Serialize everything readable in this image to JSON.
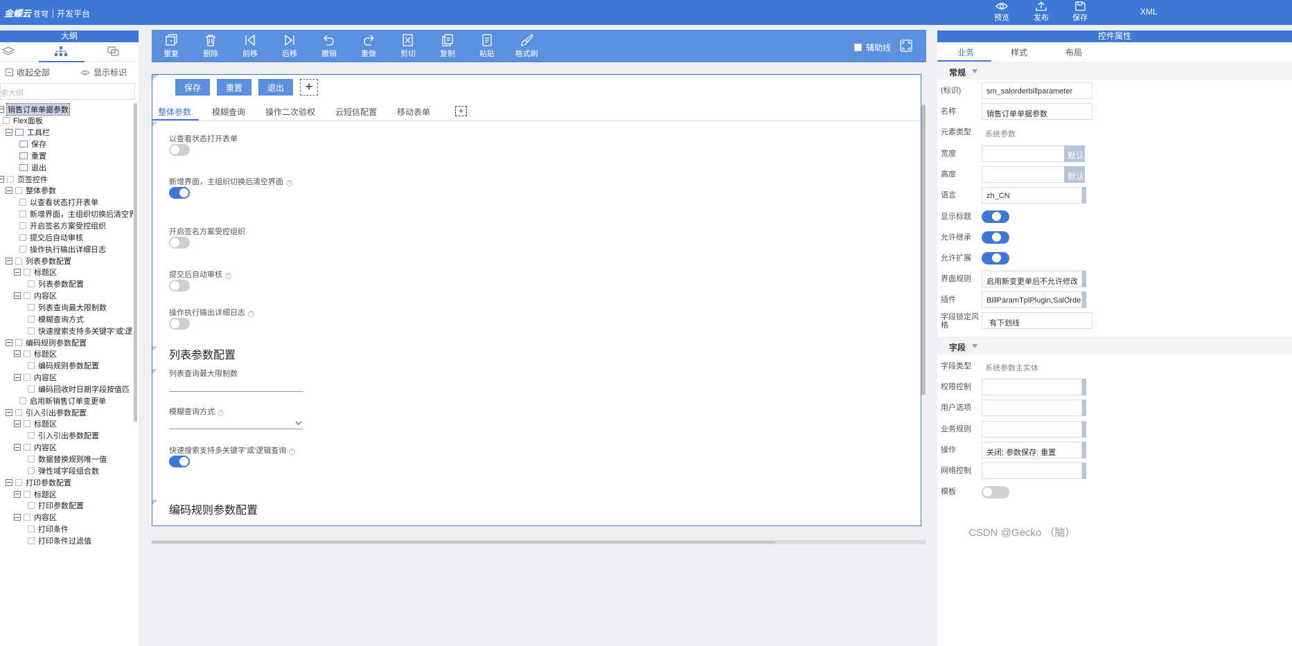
{
  "topbar": {
    "brand": "金蝶云",
    "brand_sub": "苍穹",
    "platform": "开发平台",
    "xml_label": "XML",
    "preview_label": "预览",
    "publish_label": "发布",
    "save_label": "保存"
  },
  "outline": {
    "title": "大纲",
    "collapse_all": "收起全部",
    "show_marks": "显示标识",
    "search_placeholder": "索大纲",
    "items": [
      "销售订单单据参数",
      "Flex面板",
      "工具栏",
      "保存",
      "重置",
      "退出",
      "页签控件",
      "整体参数",
      "以查看状态打开表单",
      "新增界面，主组织切换后清空界面",
      "开启签名方案受控组织",
      "提交后自动审核",
      "操作执行输出详细日志",
      "列表参数配置",
      "标题区",
      "列表参数配置",
      "内容区",
      "列表查询最大限制数",
      "模糊查询方式",
      "快速搜索支持多关键字'或'逻",
      "编码规则参数配置",
      "标题区",
      "编码规则参数配置",
      "内容区",
      "编码回收时日期字段按值匹",
      "启用新销售订单变更单",
      "引入引出参数配置",
      "标题区",
      "引入引出参数配置",
      "内容区",
      "数据替换规则唯一值",
      "弹性域字段组合数",
      "打印参数配置",
      "标题区",
      "打印参数配置",
      "内容区",
      "打印条件",
      "打印条件过滤值"
    ]
  },
  "toolbar": {
    "tools": [
      "重复",
      "删除",
      "前移",
      "后移",
      "撤销",
      "重做",
      "剪切",
      "复制",
      "粘贴",
      "格式刷"
    ],
    "aux_line": "辅助线"
  },
  "designer": {
    "buttons": [
      "保存",
      "重置",
      "退出"
    ],
    "plus": "+",
    "tabs": [
      "整体参数",
      "模糊查询",
      "操作二次验权",
      "云短信配置",
      "移动表单"
    ],
    "fields": {
      "f1": "以查看状态打开表单",
      "f2": "新增界面，主组织切换后清空界面",
      "f3": "开启签名方案受控组织",
      "f4": "提交后自动审核",
      "f5": "操作执行输出详细日志",
      "section2": "列表参数配置",
      "f6": "列表查询最大限制数",
      "f7": "模糊查询方式",
      "f8": "快速搜索支持多关键字'或'逻辑查询",
      "section3": "编码规则参数配置",
      "help": "?"
    },
    "switch_states": [
      false,
      true,
      false,
      false,
      false,
      true
    ]
  },
  "props": {
    "title": "控件属性",
    "tabs": [
      "业务",
      "样式",
      "布局"
    ],
    "group_general": "常规",
    "group_field": "字段",
    "default_btn": "默认",
    "rows": {
      "id_label": "(标识)",
      "id_value": "sm_salorderbillparameter",
      "name_label": "名称",
      "name_value": "销售订单单据参数",
      "elemtype_label": "元素类型",
      "elemtype_value": "系统参数",
      "width_label": "宽度",
      "height_label": "高度",
      "lang_label": "语言",
      "lang_value": "zh_CN",
      "showtitle_label": "显示标题",
      "inherit_label": "允许继承",
      "extend_label": "允许扩展",
      "uirule_label": "界面规则",
      "uirule_value": "启用新变更单后不允许修改",
      "plugin_label": "插件",
      "plugin_value": "BillParamTplPlugin,SalOrder",
      "lockstyle_label": "字段锁定风格",
      "lockstyle_value": "有下划线",
      "fieldtype_label": "字段类型",
      "fieldtype_value": "系统参数主实体",
      "perm_label": "权限控制",
      "useropt_label": "用户选项",
      "bizrule_label": "业务规则",
      "ops_label": "操作",
      "ops_value": "关闭; 参数保存; 重置",
      "net_label": "网络控制",
      "template_label": "模板"
    }
  },
  "watermark": "CSDN @Gecko （脑）",
  "colors": {
    "accent": "#3d78d8",
    "toolbar": "#5b8fdf"
  }
}
